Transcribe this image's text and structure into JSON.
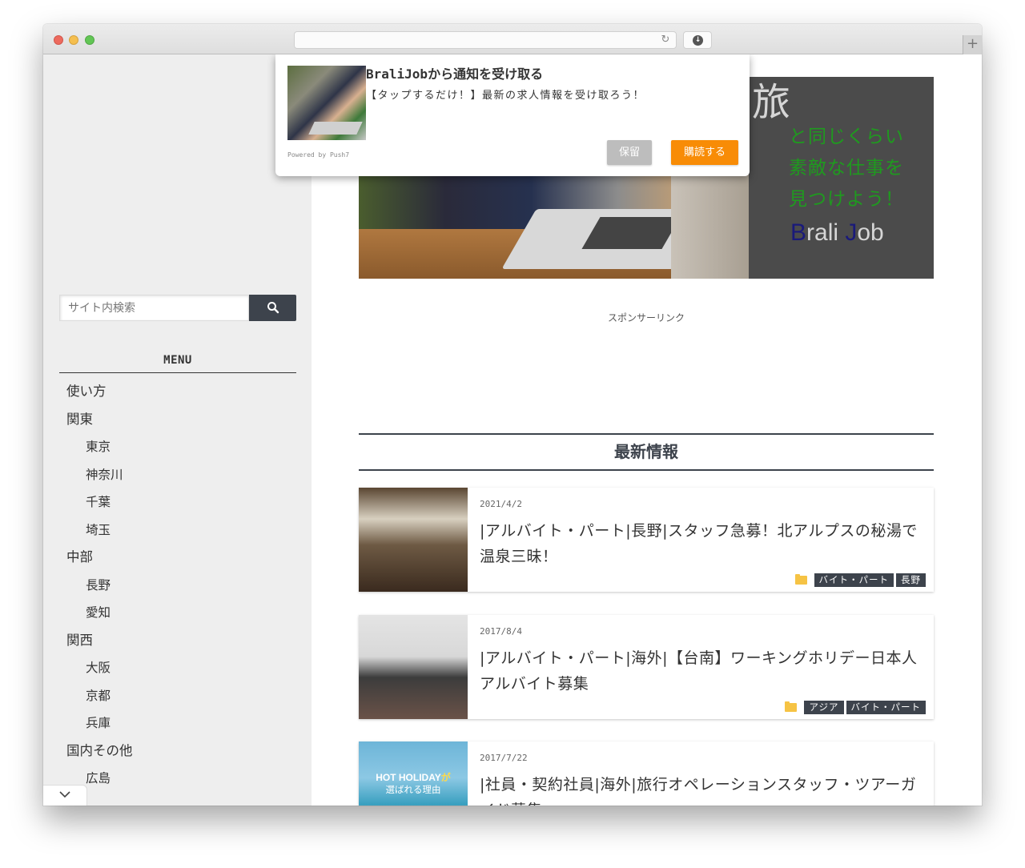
{
  "browser": {
    "url": "",
    "reload_icon": "reload-icon",
    "download_icon": "download-icon",
    "new_tab_icon": "plus-icon",
    "new_tab_glyph": "+",
    "reload_glyph": "↻",
    "download_glyph": "↓"
  },
  "sidebar": {
    "search": {
      "placeholder": "サイト内検索",
      "button_icon": "search-icon"
    },
    "menu_title": "MENU",
    "menu": [
      {
        "label": "使い方",
        "level": 0
      },
      {
        "label": "関東",
        "level": 0
      },
      {
        "label": "東京",
        "level": 1
      },
      {
        "label": "神奈川",
        "level": 1
      },
      {
        "label": "千葉",
        "level": 1
      },
      {
        "label": "埼玉",
        "level": 1
      },
      {
        "label": "中部",
        "level": 0
      },
      {
        "label": "長野",
        "level": 1
      },
      {
        "label": "愛知",
        "level": 1
      },
      {
        "label": "関西",
        "level": 0
      },
      {
        "label": "大阪",
        "level": 1
      },
      {
        "label": "京都",
        "level": 1
      },
      {
        "label": "兵庫",
        "level": 1
      },
      {
        "label": "国内その他",
        "level": 0
      },
      {
        "label": "広島",
        "level": 1
      }
    ]
  },
  "hero": {
    "kanji": "旅",
    "lines": [
      "と同じくらい",
      "素敵な仕事を",
      "見つけよう！"
    ],
    "brand_b": "B",
    "brand_rali": "rali ",
    "brand_j": "J",
    "brand_ob": "ob",
    "colors": {
      "panel": "#4b4b4b",
      "green_text": "#1f9a1f",
      "brand_blue": "#1a1a7a"
    }
  },
  "sponsor_label": "スポンサーリンク",
  "section_title": "最新情報",
  "posts": [
    {
      "date": "2021/4/2",
      "title": "|アルバイト・パート|長野|スタッフ急募！北アルプスの秘湯で温泉三昧！",
      "tags": [
        "バイト・パート",
        "長野"
      ]
    },
    {
      "date": "2017/8/4",
      "title": "|アルバイト・パート|海外|【台南】ワーキングホリデー日本人アルバイト募集",
      "tags": [
        "アジア",
        "バイト・パート"
      ]
    },
    {
      "date": "2017/7/22",
      "title": "|社員・契約社員|海外|旅行オペレーションスタッフ・ツアーガイド募集",
      "thumb_text_en": "HOT HOLIDAY",
      "thumb_text_ga": "が",
      "thumb_text_sub": "選ばれる理由",
      "tags": []
    }
  ],
  "popup": {
    "title_brand": "BraliJob",
    "title_rest": "から通知を受け取る",
    "body": "【タップするだけ！】最新の求人情報を受け取ろう！",
    "powered_by": "Powered by Push7",
    "later_label": "保留",
    "subscribe_label": "購読する",
    "colors": {
      "subscribe": "#f88c06",
      "later": "#bdbdbd"
    }
  },
  "scroll_toggle_icon": "chevron-down-icon"
}
